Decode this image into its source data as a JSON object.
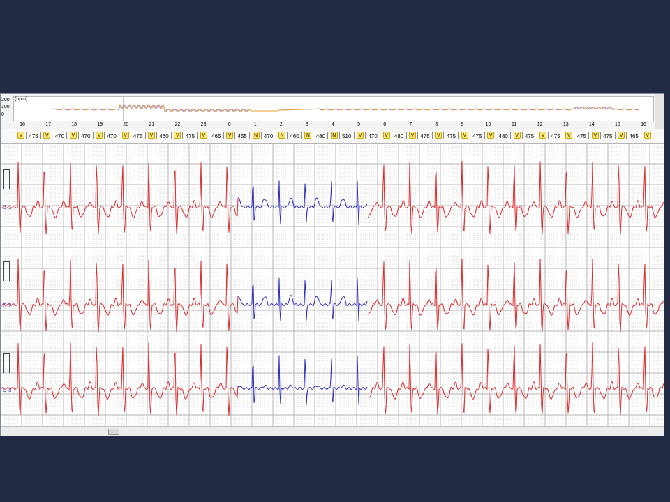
{
  "colors": {
    "background": "#222a44",
    "trace_normal": "#dd2a2a",
    "trace_highlight": "#2c2cbb",
    "trend_line1": "#f0a030",
    "trend_line2": "#8a8aff",
    "grid_major": "#b4b4b4",
    "grid_minor": "#dcdcdc"
  },
  "trend": {
    "unit_label": "(bpm)",
    "y_labels": [
      "200",
      "100",
      "0"
    ],
    "hours": [
      "16",
      "17",
      "18",
      "19",
      "20",
      "21",
      "22",
      "23",
      "0",
      "1",
      "2",
      "3",
      "4",
      "5",
      "6",
      "7",
      "8",
      "9",
      "10",
      "11",
      "12",
      "13",
      "14",
      "15",
      "16"
    ]
  },
  "beats": [
    {
      "tag": "V",
      "rr": "475"
    },
    {
      "tag": "V",
      "rr": "470"
    },
    {
      "tag": "V",
      "rr": "470"
    },
    {
      "tag": "V",
      "rr": "470"
    },
    {
      "tag": "V",
      "rr": "475"
    },
    {
      "tag": "V",
      "rr": "460"
    },
    {
      "tag": "V",
      "rr": "475"
    },
    {
      "tag": "V",
      "rr": "465"
    },
    {
      "tag": "V",
      "rr": "455"
    },
    {
      "tag": "N",
      "rr": "470"
    },
    {
      "tag": "N",
      "rr": "460"
    },
    {
      "tag": "N",
      "rr": "480"
    },
    {
      "tag": "N",
      "rr": "510"
    },
    {
      "tag": "V",
      "rr": "470"
    },
    {
      "tag": "V",
      "rr": "480"
    },
    {
      "tag": "V",
      "rr": "475"
    },
    {
      "tag": "V",
      "rr": "475"
    },
    {
      "tag": "V",
      "rr": "475"
    },
    {
      "tag": "V",
      "rr": "480"
    },
    {
      "tag": "V",
      "rr": "475"
    },
    {
      "tag": "V",
      "rr": "475"
    },
    {
      "tag": "V",
      "rr": "475"
    },
    {
      "tag": "V",
      "rr": "475"
    },
    {
      "tag": "V",
      "rr": "465"
    },
    {
      "tag": "V",
      "rr": ""
    }
  ],
  "channels": [
    {
      "label": "C 1"
    },
    {
      "label": "C 2"
    },
    {
      "label": "C 3"
    }
  ],
  "icons": {
    "calibration": "calibration-pulse-icon"
  }
}
